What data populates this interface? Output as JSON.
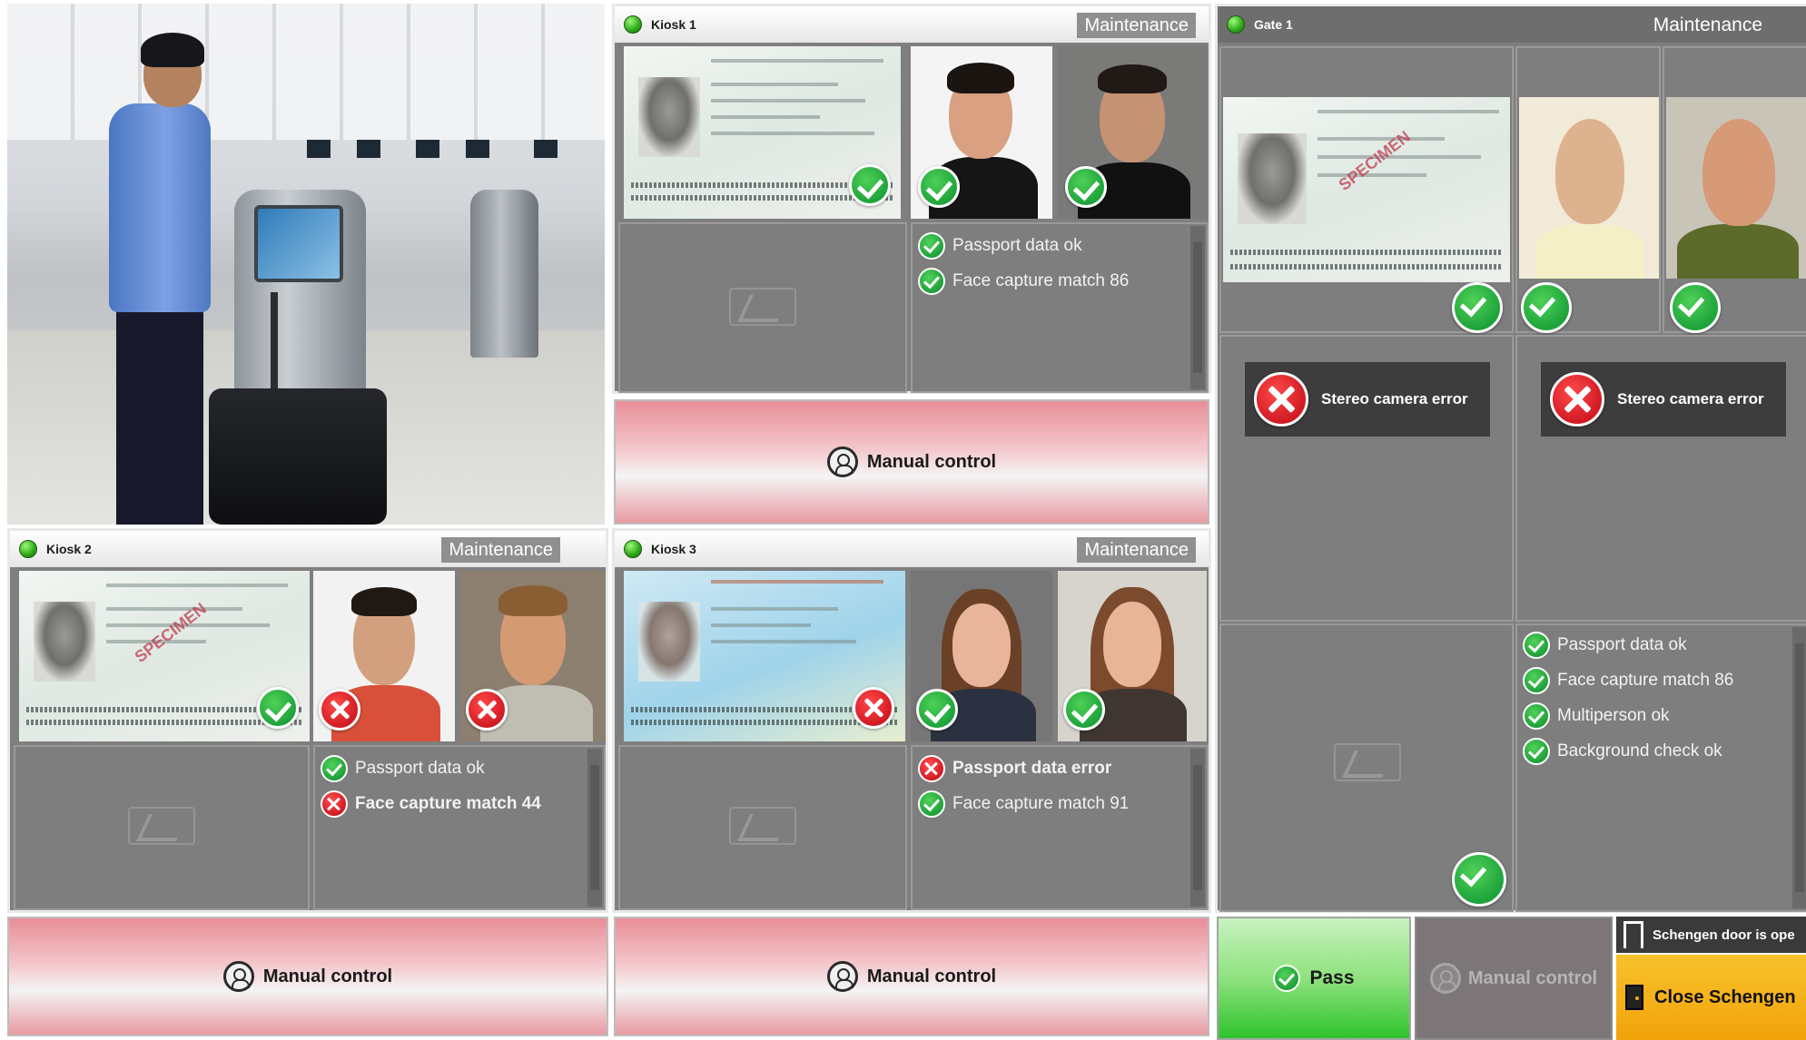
{
  "kiosks": {
    "kiosk1": {
      "title": "Kiosk 1",
      "maintenance": "Maintenance",
      "checks": [
        {
          "status": "ok",
          "label": "Passport data ok"
        },
        {
          "status": "ok",
          "label": "Face capture match 86"
        }
      ],
      "manual_label": "Manual control"
    },
    "kiosk2": {
      "title": "Kiosk 2",
      "maintenance": "Maintenance",
      "checks": [
        {
          "status": "ok",
          "label": "Passport data ok"
        },
        {
          "status": "error",
          "label": "Face capture match 44"
        }
      ],
      "manual_label": "Manual control"
    },
    "kiosk3": {
      "title": "Kiosk 3",
      "maintenance": "Maintenance",
      "checks": [
        {
          "status": "error",
          "label": "Passport data error"
        },
        {
          "status": "ok",
          "label": "Face capture match 91"
        }
      ],
      "manual_label": "Manual control"
    }
  },
  "gate": {
    "title": "Gate 1",
    "maintenance": "Maintenance",
    "camera_errors": [
      "Stereo camera error",
      "Stereo camera error"
    ],
    "checks": [
      {
        "status": "ok",
        "label": "Passport data ok"
      },
      {
        "status": "ok",
        "label": "Face capture match 86"
      },
      {
        "status": "ok",
        "label": "Multiperson ok"
      },
      {
        "status": "ok",
        "label": "Background check ok"
      }
    ],
    "pass_label": "Pass",
    "manual_label": "Manual control",
    "schengen_status": "Schengen door is ope",
    "close_schengen_label": "Close Schengen"
  },
  "colors": {
    "ok_green": "#1fa03a",
    "error_red": "#d11a23",
    "panel_gray": "#7f7f7f",
    "manual_pink": "#e88e97",
    "pass_green": "#2ec22d",
    "close_yellow": "#f2a20a"
  }
}
